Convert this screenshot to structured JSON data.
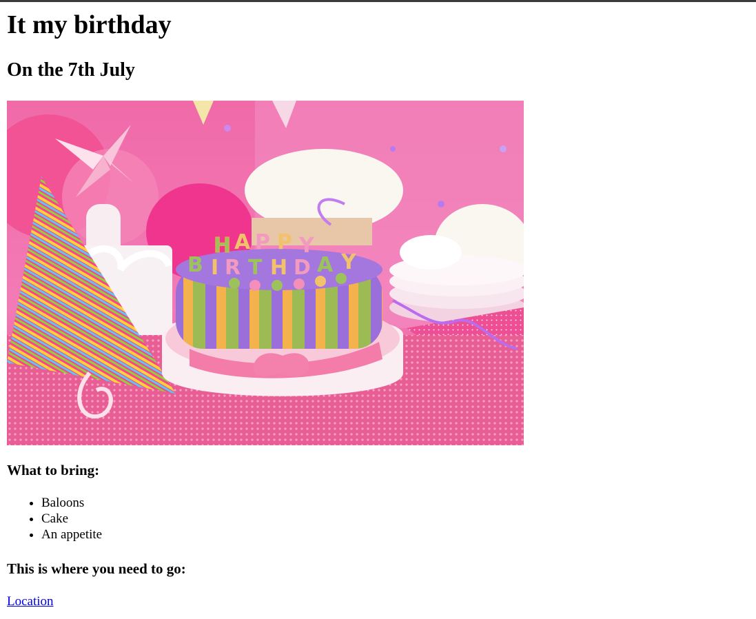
{
  "page": {
    "title": "It my birthday",
    "subtitle": "On the 7th July",
    "image": {
      "description_icon": "birthday-cake-photo",
      "cake_lettering": "HAPPY BIRTHDAY"
    },
    "bring_heading": "What to bring:",
    "bring_items": [
      "Baloons",
      "Cake",
      "An appetite"
    ],
    "where_heading": "This is where you need to go:",
    "location_link": "Location"
  },
  "colors": {
    "link": "#0000ee",
    "topbar": "#3a3a3a",
    "background_pink": "#f25fa4"
  }
}
